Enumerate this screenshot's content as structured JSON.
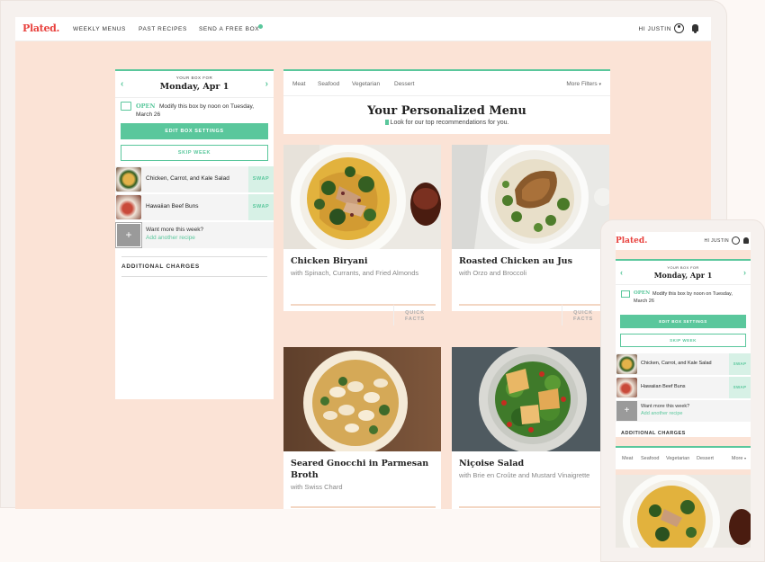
{
  "brand": "Plated.",
  "nav": {
    "items": [
      "WEEKLY MENUS",
      "PAST RECIPES",
      "SEND A FREE BOX"
    ],
    "greeting": "HI JUSTIN"
  },
  "box": {
    "for_label": "YOUR BOX FOR",
    "date": "Monday, Apr 1",
    "open_label": "OPEN",
    "open_text": "Modify this box by noon on Tuesday, March 26",
    "edit_button": "EDIT BOX SETTINGS",
    "skip_button": "SKIP WEEK",
    "recipes": [
      {
        "name": "Chicken, Carrot, and Kale Salad",
        "action": "SWAP"
      },
      {
        "name": "Hawaiian Beef Buns",
        "action": "SWAP"
      }
    ],
    "want_more": "Want more this week?",
    "add_another": "Add another recipe",
    "additional_charges": "ADDITIONAL CHARGES"
  },
  "filters": {
    "items": [
      "Meat",
      "Seafood",
      "Vegetarian",
      "Dessert"
    ],
    "more": "More Filters",
    "mobile_more": "More"
  },
  "menu": {
    "title": "Your Personalized Menu",
    "subtitle": "Look for our top recommendations for you."
  },
  "cards": [
    {
      "title": "Chicken Biryani",
      "desc": "with Spinach, Currants, and Fried Almonds",
      "badge": "QUICK FACTS"
    },
    {
      "title": "Roasted Chicken au Jus",
      "desc": "with Orzo and Broccoli",
      "badge": "QUICK FACTS"
    },
    {
      "title": "Seared Gnocchi in Parmesan Broth",
      "desc": "with Swiss Chard"
    },
    {
      "title": "Niçoise Salad",
      "desc": "with Brie en Croûte and Mustard Vinaigrette"
    }
  ],
  "colors": {
    "accent": "#5ac79c",
    "brand": "#e8413d",
    "background": "#fbe3d6"
  }
}
